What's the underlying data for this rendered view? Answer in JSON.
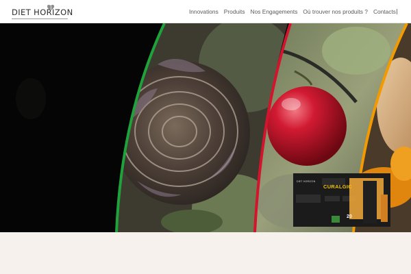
{
  "header": {
    "logo": {
      "part1": "DIET",
      "part2": "H",
      "part3": "RIZ",
      "part4": "N",
      "icon": "heart-leaf-icon"
    },
    "nav": [
      {
        "label": "Innovations"
      },
      {
        "label": "Produits"
      },
      {
        "label": "Nos Engagements"
      },
      {
        "label": "Où trouver nos produits ?"
      },
      {
        "label": "Contacts"
      }
    ]
  },
  "hero": {
    "product": {
      "brand": "DIET HORIZON",
      "name": "CURALGIC",
      "count": "20"
    },
    "colors": {
      "green_stripe": "#1ea33b",
      "red_stripe": "#d4132c",
      "orange_stripe": "#f39a00",
      "background": "#050505",
      "turmeric": "#e0860f"
    }
  },
  "footer": {
    "background": "#f6f1ed"
  }
}
